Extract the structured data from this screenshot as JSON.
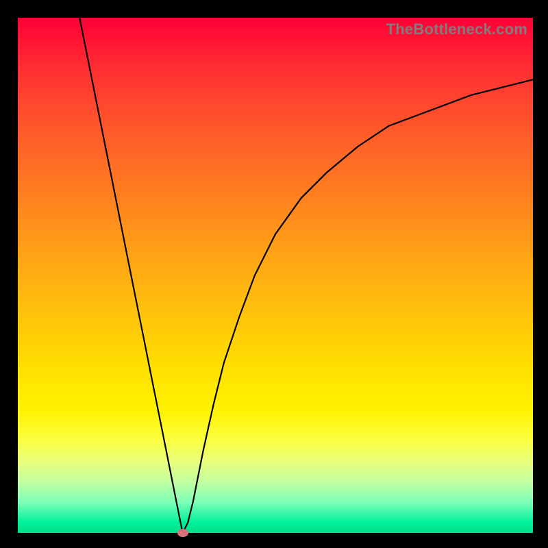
{
  "watermark": "TheBottleneck.com",
  "chart_data": {
    "type": "line",
    "title": "",
    "xlabel": "",
    "ylabel": "",
    "xlim": [
      0,
      100
    ],
    "ylim": [
      0,
      100
    ],
    "grid": false,
    "legend": false,
    "curve_points": [
      {
        "x": 12,
        "y": 100
      },
      {
        "x": 14,
        "y": 90
      },
      {
        "x": 16,
        "y": 80
      },
      {
        "x": 18,
        "y": 70
      },
      {
        "x": 20,
        "y": 60
      },
      {
        "x": 22,
        "y": 50
      },
      {
        "x": 24,
        "y": 40
      },
      {
        "x": 26,
        "y": 30
      },
      {
        "x": 28,
        "y": 20
      },
      {
        "x": 30,
        "y": 10
      },
      {
        "x": 32,
        "y": 0
      },
      {
        "x": 33,
        "y": 2
      },
      {
        "x": 34,
        "y": 6
      },
      {
        "x": 36,
        "y": 16
      },
      {
        "x": 38,
        "y": 25
      },
      {
        "x": 40,
        "y": 33
      },
      {
        "x": 43,
        "y": 42
      },
      {
        "x": 46,
        "y": 50
      },
      {
        "x": 50,
        "y": 58
      },
      {
        "x": 55,
        "y": 65
      },
      {
        "x": 60,
        "y": 70
      },
      {
        "x": 66,
        "y": 75
      },
      {
        "x": 72,
        "y": 79
      },
      {
        "x": 80,
        "y": 82
      },
      {
        "x": 88,
        "y": 85
      },
      {
        "x": 100,
        "y": 88
      }
    ],
    "marker": {
      "x": 32,
      "y": 0,
      "color": "#d9717a"
    }
  }
}
